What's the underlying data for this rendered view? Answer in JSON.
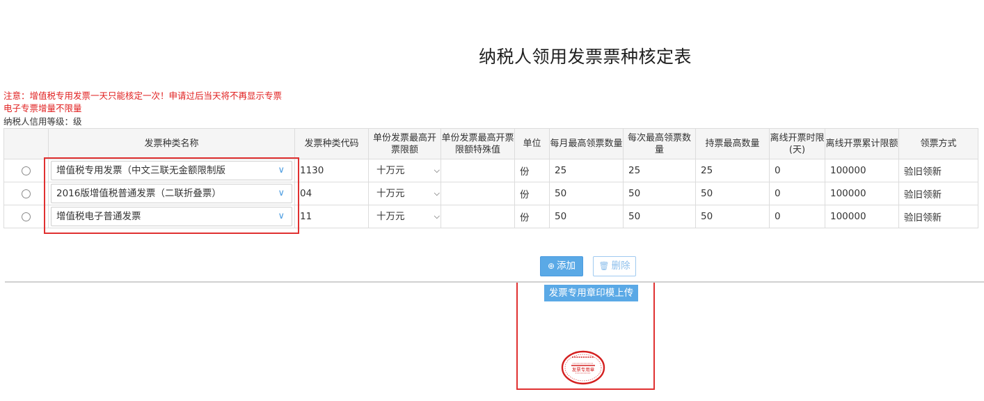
{
  "page_title": "纳税人领用发票票种核定表",
  "notice_line1": "注意：增值税专用发票一天只能核定一次！申请过后当天将不再显示专票",
  "notice_line2": "电子专票增量不限量",
  "credit_level": "纳税人信用等级：级",
  "table": {
    "headers": {
      "type_name": "发票种类名称",
      "type_code": "发票种类代码",
      "max_amount": "单份发票最高开票限额",
      "max_amount_special": "单份发票最高开票限额特殊值",
      "unit": "单位",
      "monthly_max": "每月最高领票数量",
      "per_time_max": "每次最高领票数量",
      "hold_max": "持票最高数量",
      "offline_hours": "离线开票时限(天)",
      "offline_total": "离线开票累计限额",
      "method": "领票方式"
    },
    "rows": [
      {
        "type_name": "增值税专用发票（中文三联无金额限制版",
        "type_code": "1130",
        "max_amount": "十万元",
        "max_amount_special": "",
        "unit": "份",
        "monthly_max": "25",
        "per_time_max": "25",
        "hold_max": "25",
        "offline_hours": "0",
        "offline_total": "100000",
        "method": "验旧领新"
      },
      {
        "type_name": "2016版增值税普通发票（二联折叠票）",
        "type_code": "04",
        "max_amount": "十万元",
        "max_amount_special": "",
        "unit": "份",
        "monthly_max": "50",
        "per_time_max": "50",
        "hold_max": "50",
        "offline_hours": "0",
        "offline_total": "100000",
        "method": "验旧领新"
      },
      {
        "type_name": "增值税电子普通发票",
        "type_code": "11",
        "max_amount": "十万元",
        "max_amount_special": "",
        "unit": "份",
        "monthly_max": "50",
        "per_time_max": "50",
        "hold_max": "50",
        "offline_hours": "0",
        "offline_total": "100000",
        "method": "验旧领新"
      }
    ]
  },
  "buttons": {
    "add": "添加",
    "delete": "删除"
  },
  "upload": {
    "label": "发票专用章印模上传",
    "seal_text_bottom": "发票专用章"
  },
  "colors": {
    "notice": "#e02020",
    "accent": "#5aa9e6",
    "highlight_box": "#e03030",
    "seal": "#d42020"
  },
  "icons": {
    "add": "plus-circle-icon",
    "delete": "trash-icon",
    "dropdown": "chevron-down-icon"
  }
}
